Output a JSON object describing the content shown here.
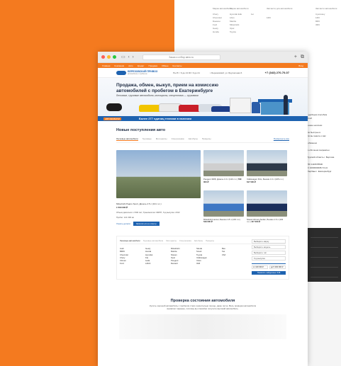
{
  "background_table": {
    "col1_header": "Марка автомобиля",
    "col1": [
      "Chery",
      "Chevrolet",
      "Daewoo",
      "Ford",
      "Geely",
      "Honda"
    ],
    "col2_header": "Марка автомобиля",
    "col2": [
      "Hyundai Edu",
      "Lifan",
      "Mazda",
      "Mitsubishi",
      "Opel",
      "Toyota"
    ],
    "col2_count": "1м",
    "col3_header": "Запчасти для автомобиля",
    "col3": [
      "1М3"
    ],
    "col4_header": "Запчасти автомобиля",
    "col4": [
      "Сумочкеу",
      "1М3",
      "8М3",
      "3М3"
    ]
  },
  "right_side_text": [
    "и удобным способом",
    "",
    "астей",
    "",
    "в наше наличии",
    "",
    "ели быстрее в",
    "ели вы знаете о вас",
    "",
    "с обменом",
    "",
    "ло обо меня эхиревлен",
    "",
    "нбурский область г. Вертова",
    "",
    "1ЛО 1116678600",
    "п/с 1000000008-74 к/с",
    "Сбербанк г. Екатеринбург"
  ],
  "window": {
    "url": "Заказ и отбор авто.ru",
    "topnav": [
      "Главная",
      "Компания",
      "Авто",
      "Кредит",
      "Продажа",
      "Обмен",
      "Контакты"
    ],
    "topnav_right": "Вход"
  },
  "header": {
    "logo_title": "БЕРЕЗОВСКИЙ ПРИВОЗ",
    "logo_sub": "автомобили с пробегом",
    "hours": "Пн-Пт / 9 до 21:00 / 9 до 21",
    "address": "г. Березовский, ул. Брусничная 6",
    "phone": "+7 (343) 270-70-07"
  },
  "hero": {
    "title": "Продажа, обмен, выкуп, прием на комиссию автомобилей с пробегом в Екатеринбурге",
    "subtitle": "Легковые, грузовые автомобили, мотоциклы, спецтехника — грузовики",
    "bar_pill": "АВТОМОБИЛИ",
    "bar_text": "Более 277 единиц техники в наличии"
  },
  "new_arrivals": {
    "title": "Новые поступления авто",
    "tabs": [
      "Легковые автомобили",
      "Грузовые",
      "Мотоциклы",
      "Спецтехника",
      "Автобусы",
      "Прицепы"
    ],
    "all_link": "Посмотреть все",
    "big": {
      "title": "Mitsubishi Pajero Sport, Дизель 2.5 л (131 л.с.)",
      "price": "1 500 000 ₽",
      "spec1": "Объем двигателя: 2.500 см³, Трансмиссия: МКПП, Год выпуска: 2013",
      "spec2": "Пробег: 121 000 км",
      "link": "Узнать детали",
      "button": "Записаться на осмотр"
    },
    "small": [
      {
        "title": "Peugeot 3008, Дизель 1.6 л (120 л.с.)",
        "price": "790 000 ₽",
        "color": "#cfcfcf"
      },
      {
        "title": "Volkswagen Polo, Бензин 1.6 л (105 л.с.)",
        "price": "617 000 ₽",
        "color": "#2e3a4a"
      },
      {
        "title": "Mitsubishi Lancer, Бензин 1.8 л (143 л.с.)",
        "price": "549 000 ₽",
        "color": "#3f78c4"
      },
      {
        "title": "Nissan Almera Sedan, Бензин 1.6 л (102 л.с.)",
        "price": "417 000 ₽",
        "color": "#1b2f5c"
      }
    ]
  },
  "filter": {
    "tabs": [
      "Легковые автомобили",
      "Грузовые автомобили",
      "Мотоциклы",
      "Спецтехника",
      "Автобусы",
      "Прицепы"
    ],
    "brand_cols": [
      [
        "Audi",
        "BMW",
        "Chevrolet",
        "Chery",
        "Citroen",
        "Ford"
      ],
      [
        "Geely",
        "Honda",
        "Hyundai",
        "Kia",
        "Lada",
        "LADA"
      ],
      [
        "Mitsubishi",
        "Mazda",
        "Nissan",
        "Opel",
        "Peugeot",
        "Renault"
      ],
      [
        "Skoda",
        "Smart",
        "Toyota",
        "Volkswagen",
        "Volvo",
        "ЗАЗ"
      ],
      [
        "Ваз",
        "Газ",
        "УАЗ",
        "",
        "",
        ""
      ]
    ],
    "selects": [
      "Выберите марку",
      "Выберите модель",
      "Выберите тип",
      "Год выпуска"
    ],
    "price_from": "от 100 000 ₽",
    "price_to": "до 5 000 000 ₽",
    "button": "Показать найденные 348"
  },
  "check": {
    "title": "Проверка состояния автомобиля",
    "text": "Купить хороший автомобиль с пробегом стало значительно проще, даже легче. Весь проверки автомобиля выявляет заранее, поэтому вы спокойно получите высокий автомобиль."
  },
  "colors": {
    "orange": "#f47a1f",
    "blue": "#1d62b0"
  }
}
